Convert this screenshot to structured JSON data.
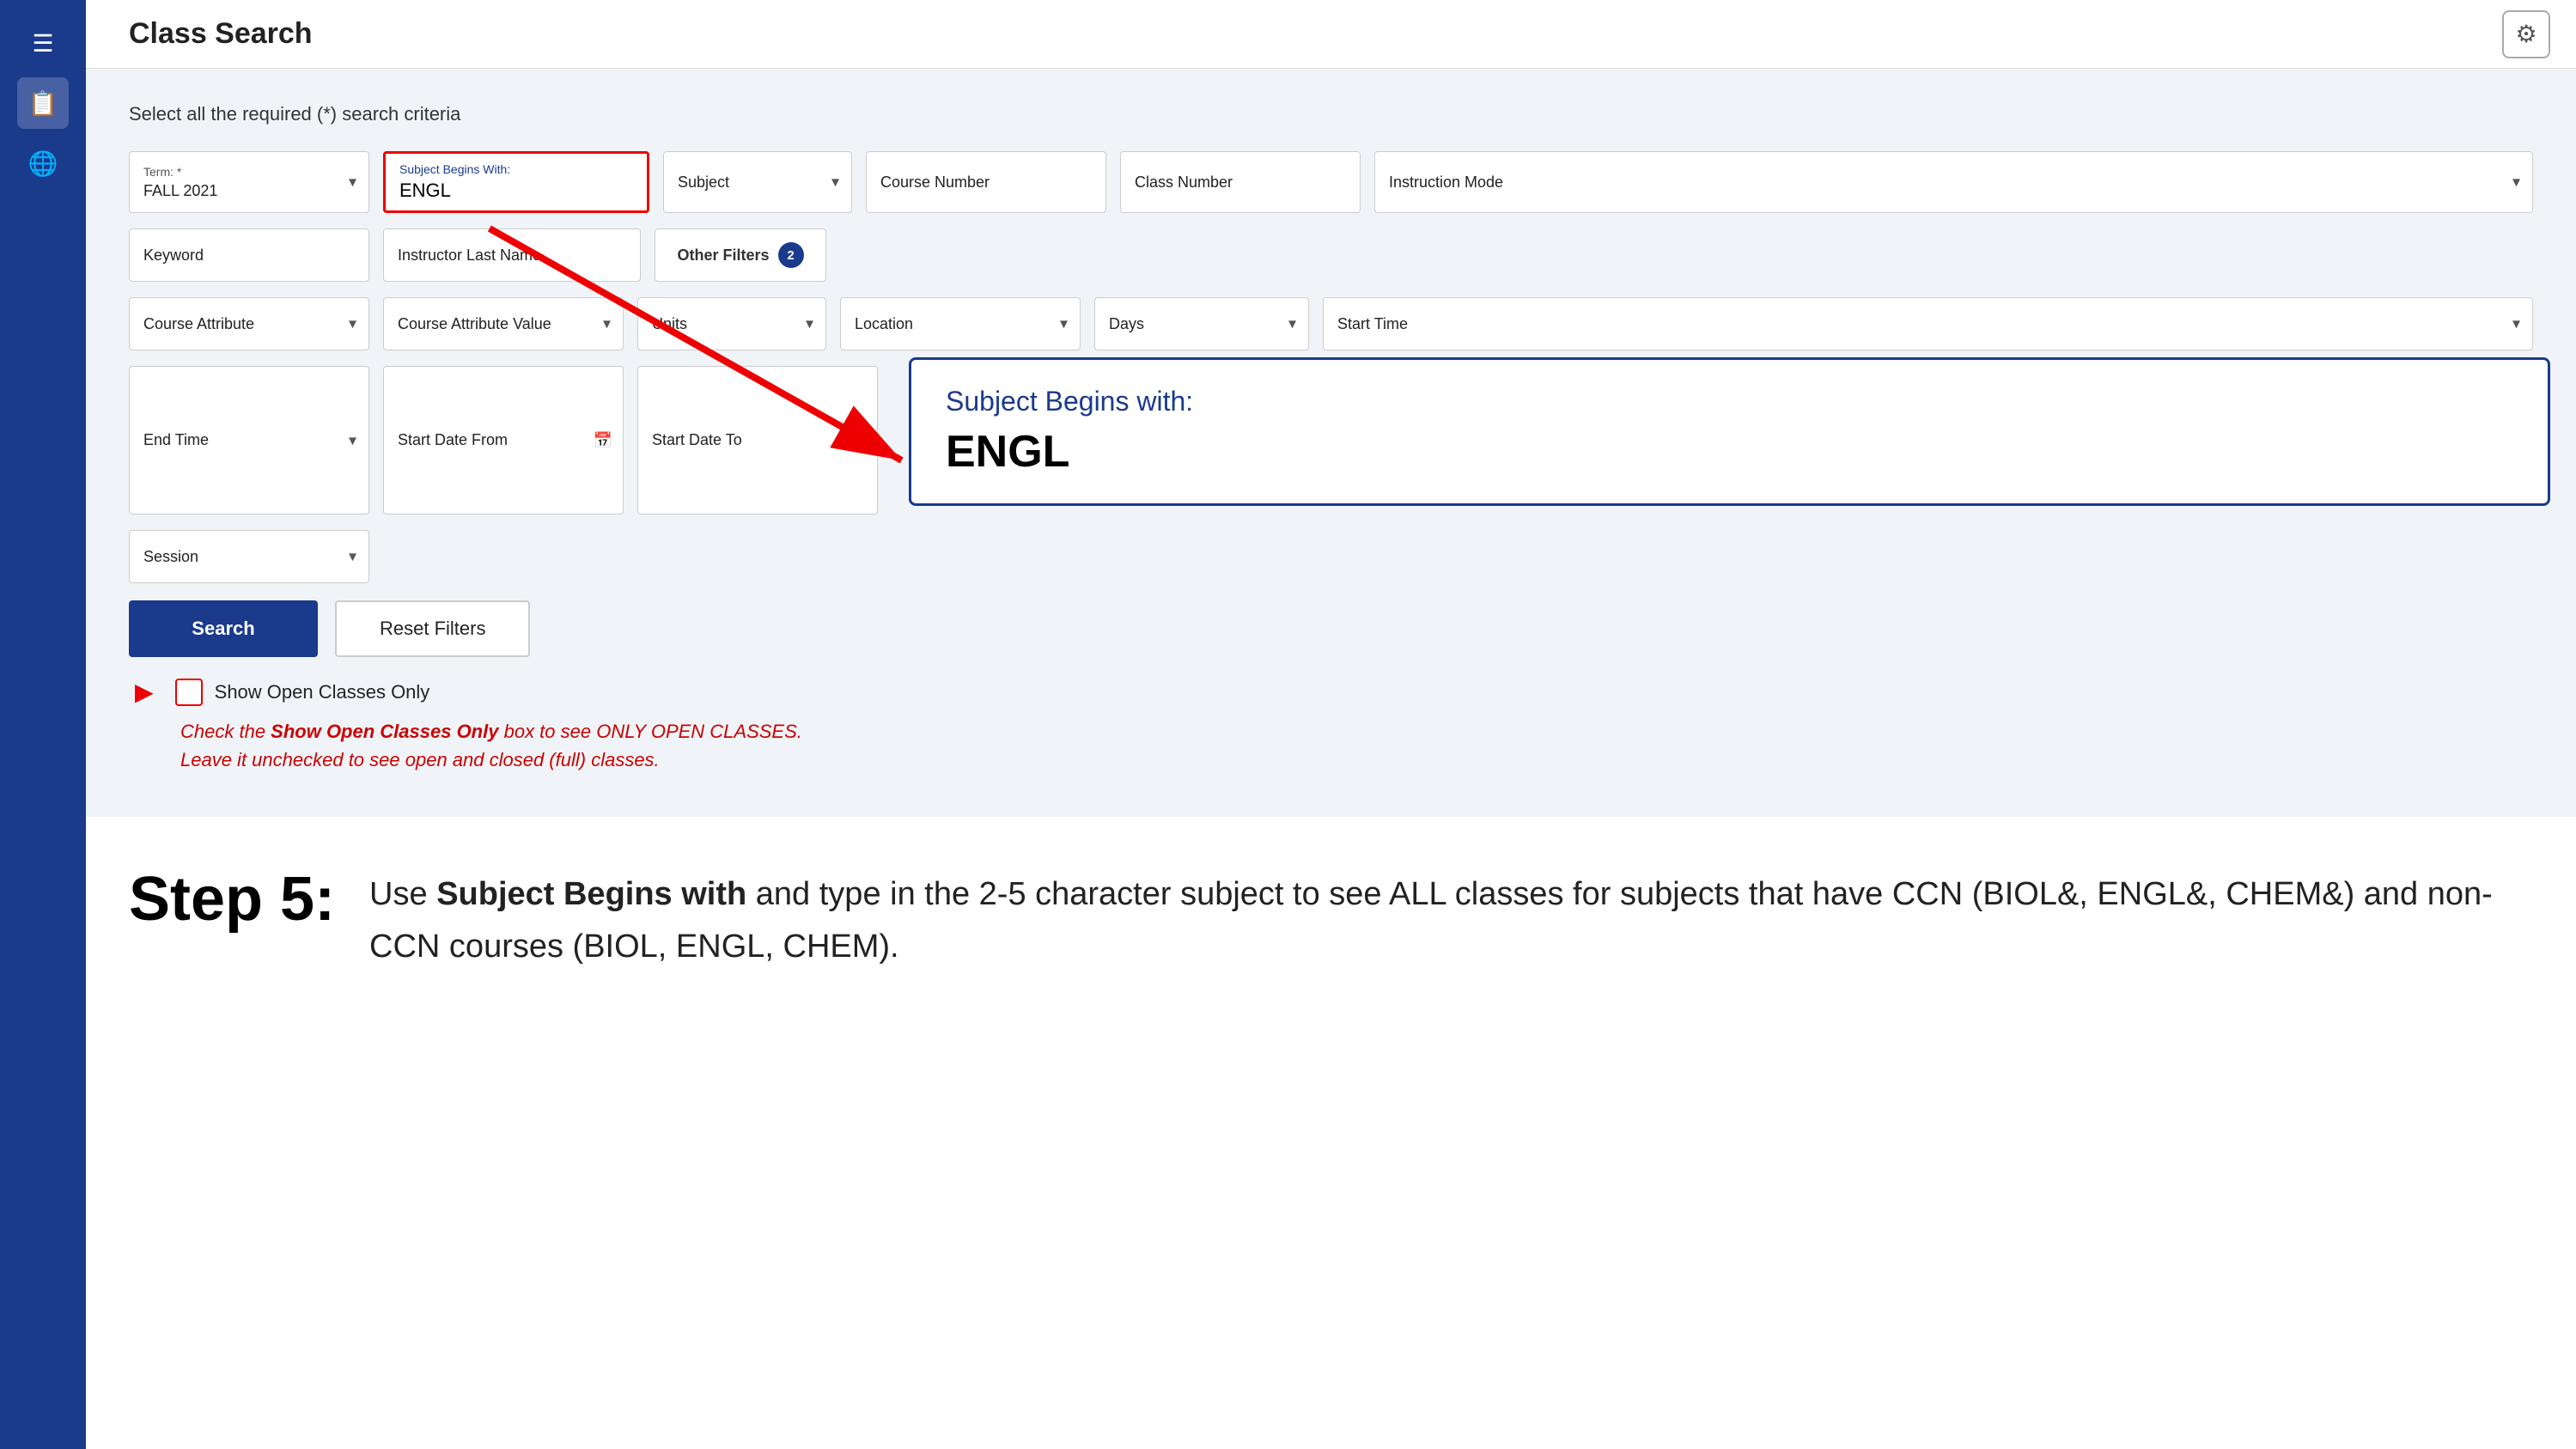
{
  "app": {
    "title": "Class Search"
  },
  "sidebar": {
    "icons": [
      "☰",
      "📋",
      "🌐"
    ]
  },
  "topbar": {
    "title": "Class Search",
    "gear_icon": "⚙"
  },
  "form": {
    "section_label": "Select all the required (*) search criteria",
    "term_label": "Term: *",
    "term_value": "FALL 2021",
    "subject_begins_label": "Subject Begins With:",
    "subject_begins_value": "ENGL",
    "subject_label": "Subject",
    "course_number_label": "Course Number",
    "class_number_label": "Class Number",
    "instruction_mode_label": "Instruction Mode",
    "keyword_label": "Keyword",
    "instructor_label": "Instructor Last Name",
    "other_filters_label": "Other Filters",
    "other_filters_badge": "2",
    "course_attr_label": "Course Attribute",
    "course_attr_val_label": "Course Attribute Value",
    "units_label": "Units",
    "location_label": "Location",
    "days_label": "Days",
    "start_time_label": "Start Time",
    "end_time_label": "End Time",
    "start_date_from_label": "Start Date From",
    "start_date_to_label": "Start Date To",
    "session_label": "Session",
    "search_button": "Search",
    "reset_button": "Reset Filters",
    "show_open_label": "Show Open Classes Only"
  },
  "popup": {
    "title": "Subject Begins with:",
    "value": "ENGL"
  },
  "annotation": {
    "line1_prefix": "Check the ",
    "line1_bold": "Show Open Classes Only",
    "line1_suffix": " box to see ONLY OPEN CLASSES.",
    "line2": "Leave it unchecked to see open and closed (full) classes."
  },
  "step": {
    "label": "Step 5:",
    "description_part1": "Use ",
    "description_bold": "Subject Begins with",
    "description_part2": " and type in the 2-5 character subject to see ALL classes for subjects that have CCN (BIOL&, ENGL&, CHEM&) and non-CCN courses (BIOL, ENGL, CHEM)."
  }
}
